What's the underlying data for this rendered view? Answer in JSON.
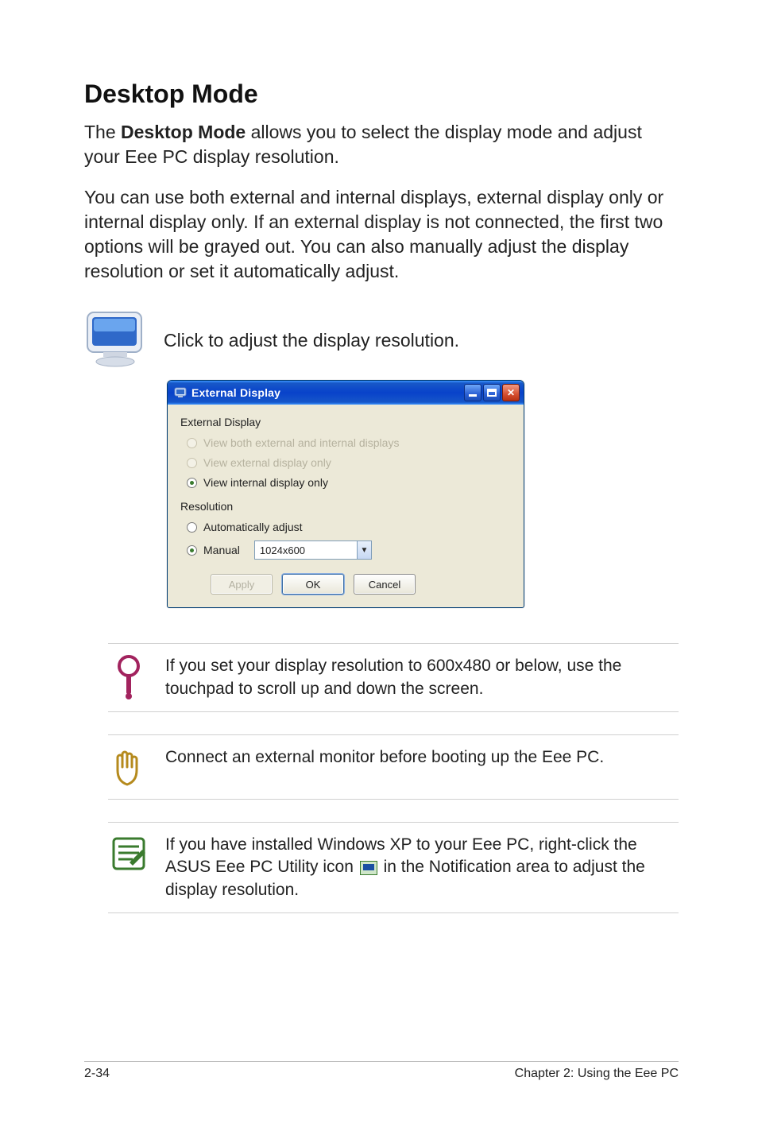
{
  "page": {
    "section_title": "Desktop Mode",
    "intro_1_pre": "The ",
    "intro_1_bold": "Desktop Mode",
    "intro_1_post": " allows you to select the display mode and adjust your Eee PC display resolution.",
    "intro_2": "You can use both external and internal displays, external display only or internal display only. If an external display is not connected, the first two options will be grayed out. You can also manually adjust the display resolution or set it automatically adjust.",
    "icon_caption": "Click to adjust the display resolution."
  },
  "dialog": {
    "title": "External Display",
    "group1_label": "External Display",
    "radios1": [
      {
        "label": "View both external and internal displays",
        "state": "disabled"
      },
      {
        "label": "View external display only",
        "state": "disabled"
      },
      {
        "label": "View internal display only",
        "state": "selected"
      }
    ],
    "group2_label": "Resolution",
    "radios2": [
      {
        "label": "Automatically adjust",
        "state": "unselected"
      },
      {
        "label": "Manual",
        "state": "selected"
      }
    ],
    "select_value": "1024x600",
    "buttons": {
      "apply": "Apply",
      "ok": "OK",
      "cancel": "Cancel"
    }
  },
  "notes": {
    "tip": "If you set your display resolution to 600x480 or below, use the touchpad to scroll up and down the screen.",
    "hand": "Connect an external monitor before booting up the Eee PC.",
    "pad_pre": "If you have installed Windows XP to your Eee PC, right-click the ASUS Eee PC Utility icon ",
    "pad_post": " in the Notification area to adjust the display resolution."
  },
  "footer": {
    "left": "2-34",
    "right": "Chapter 2: Using the Eee PC"
  }
}
